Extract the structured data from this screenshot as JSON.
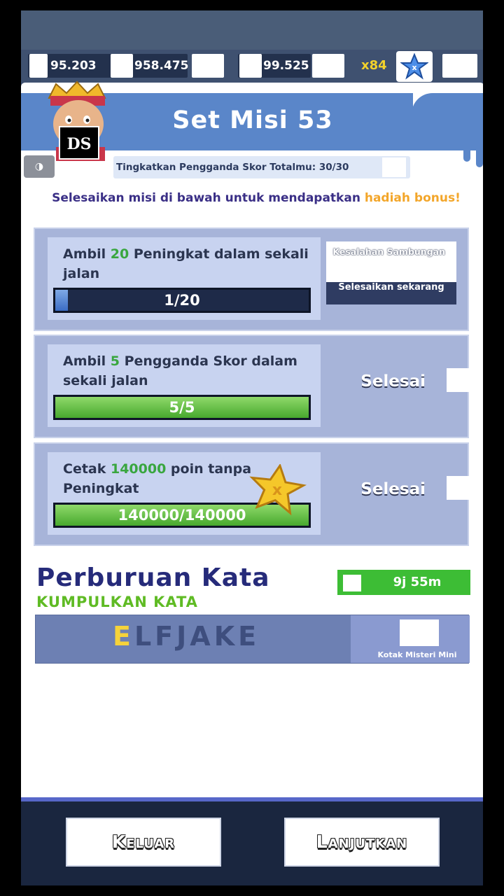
{
  "currencies": [
    {
      "value": "95.203"
    },
    {
      "value": "958.475"
    },
    {
      "value": "99.525"
    }
  ],
  "multiplier": "x84",
  "watermark": "DS",
  "visibility_icon": "◑",
  "title": "Set Misi 53",
  "subtitle": "Tingkatkan Pengganda Skor Totalmu: 30/30",
  "instruction": {
    "main": "Selesaikan misi di bawah untuk mendapatkan ",
    "highlight": "hadiah bonus!"
  },
  "missions": [
    {
      "text_before": "Ambil ",
      "num": "20",
      "text_after": " Peningkat dalam sekali jalan",
      "progress_label": "1/20",
      "progress_fraction": 0.05,
      "status": "pending",
      "error_text": "Kesalahan Sambungan",
      "finish_now": "Selesaikan sekarang"
    },
    {
      "text_before": "Ambil ",
      "num": "5",
      "text_after": " Pengganda Skor dalam sekali jalan",
      "progress_label": "5/5",
      "progress_fraction": 1.0,
      "status": "Selesai"
    },
    {
      "text_before": "Cetak ",
      "num": "140000",
      "text_after": " poin tanpa Peningkat",
      "progress_label": "140000/140000",
      "progress_fraction": 1.0,
      "status": "Selesai"
    }
  ],
  "word_hunt": {
    "title": "Perburuan Kata",
    "subtitle": "KUMPULKAN KATA",
    "timer": "9j 55m",
    "word_first": "E",
    "word_rest": "LFJAKE",
    "mini_box_label": "Kotak Misteri Mini"
  },
  "buttons": {
    "exit": "Keluar",
    "continue": "Lanjutkan"
  },
  "colors": {
    "accent_green": "#39a63f",
    "accent_orange": "#f3a62a",
    "title_blue": "#262b7a",
    "banner_blue": "#5a86c9"
  }
}
